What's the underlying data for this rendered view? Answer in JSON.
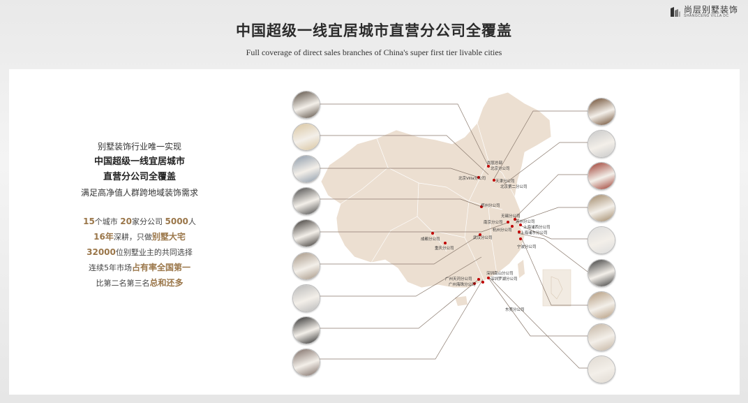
{
  "header": {
    "title": "中国超级一线宜居城市直营分公司全覆盖",
    "subtitle": "Full coverage of direct sales branches of China's super first tier livable cities"
  },
  "logo": {
    "name_cn": "尚层别墅装饰",
    "name_en": "SHANGCENG VILLA DC"
  },
  "intro": {
    "line1": "别墅装饰行业唯一实现",
    "line2": "中国超级一线宜居城市",
    "line3": "直营分公司全覆盖",
    "line4": "满足高净值人群跨地域装饰需求"
  },
  "stats": {
    "s1": {
      "n1": "15",
      "t1": "个城市 ",
      "n2": "20",
      "t2": "家分公司 ",
      "n3": "5000",
      "t3": "人"
    },
    "s2": {
      "n1": "16年",
      "t1": "深耕，只做",
      "n2": "别墅大宅"
    },
    "s3": {
      "n1": "32000",
      "t1": "位别墅业主的共同选择"
    },
    "s4": {
      "t1": "连续5年市场",
      "n1": "占有率全国第一"
    },
    "s5": {
      "t1": "比第二名第三名",
      "n1": "总和还多"
    }
  },
  "branches": {
    "hq": "尚层总部",
    "beijing": "北京分公司",
    "beijing_villa": "北京Villa分公司",
    "tianjin": "天津分公司",
    "beijing2": "北京第二分公司",
    "zhengzhou": "郑州分公司",
    "nanjing": "南京分公司",
    "wuxi": "无锡分公司",
    "suzhou": "苏州分公司",
    "shanghai_west": "上海浦西分公司",
    "hangzhou": "杭州分公司",
    "shanghai_east": "上海浦东分公司",
    "wuhan": "武汉分公司",
    "chengdu": "成都分公司",
    "chongqing": "重庆分公司",
    "ningbo": "宁波分公司",
    "shenzhen_nanshan": "深圳南山分公司",
    "guangzhou_tianhe": "广州天河分公司",
    "shenzhen_luohu": "深圳罗湖分公司",
    "guangzhou_haizhu": "广州海珠分公司",
    "dongguan": "东莞分公司"
  },
  "colors": {
    "map": "#ecdfd1",
    "accent": "#9a7649",
    "dot": "#c00000"
  },
  "photos_left": [
    {
      "icon": "office-photo-1",
      "tone": "#5a4f44"
    },
    {
      "icon": "office-photo-2",
      "tone": "#d9c5a0"
    },
    {
      "icon": "office-photo-3",
      "tone": "#8c9aaa"
    },
    {
      "icon": "office-photo-4",
      "tone": "#4a4a4a"
    },
    {
      "icon": "office-photo-5",
      "tone": "#3a3633"
    },
    {
      "icon": "office-photo-6",
      "tone": "#a59584"
    },
    {
      "icon": "office-photo-7",
      "tone": "#b8b8b8"
    },
    {
      "icon": "office-photo-8",
      "tone": "#2e2e2e"
    },
    {
      "icon": "office-photo-9",
      "tone": "#7d6d66"
    }
  ],
  "photos_right": [
    {
      "icon": "office-photo-10",
      "tone": "#6b4a2f"
    },
    {
      "icon": "office-photo-11",
      "tone": "#c9c9c9"
    },
    {
      "icon": "office-photo-12",
      "tone": "#9c3a2e"
    },
    {
      "icon": "office-photo-13",
      "tone": "#a08868"
    },
    {
      "icon": "office-photo-14",
      "tone": "#dcdcdc"
    },
    {
      "icon": "office-photo-15",
      "tone": "#3c3c3c"
    },
    {
      "icon": "office-photo-16",
      "tone": "#b39a7d"
    },
    {
      "icon": "office-photo-17",
      "tone": "#c4b5a3"
    },
    {
      "icon": "office-photo-18",
      "tone": "#e0dad2"
    }
  ]
}
